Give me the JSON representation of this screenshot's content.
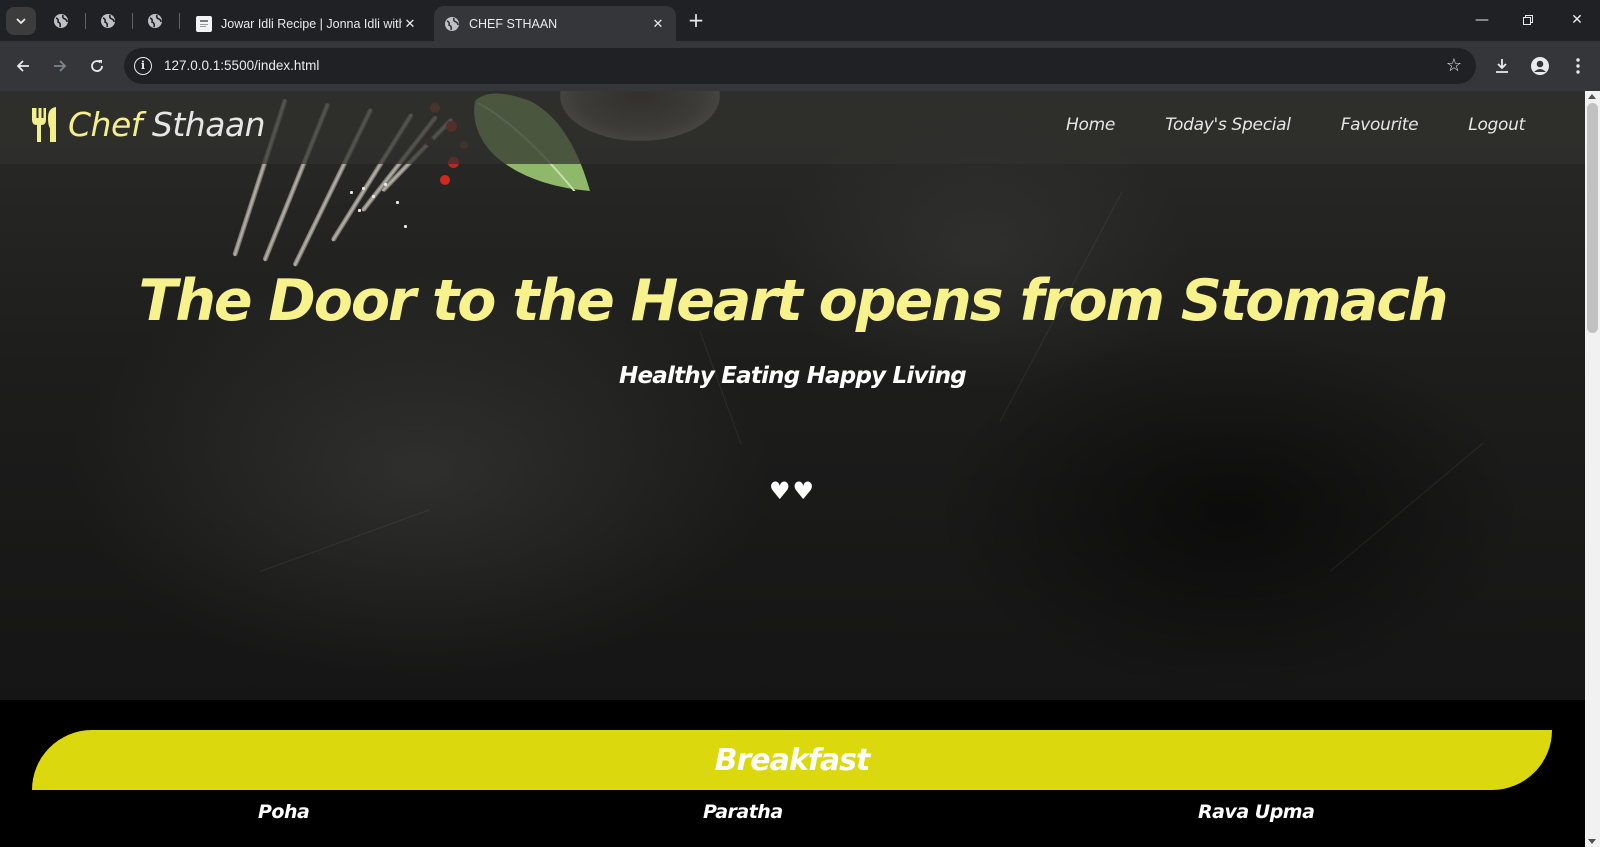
{
  "browser": {
    "tabs": [
      {
        "title": "Jowar Idli Recipe | Jonna Idli with",
        "active": false
      },
      {
        "title": "CHEF STHAAN",
        "active": true
      }
    ],
    "url": "127.0.0.1:5500/index.html"
  },
  "site": {
    "brand": {
      "first": "Chef",
      "second": "Sthaan"
    },
    "nav": [
      "Home",
      "Today's Special",
      "Favourite",
      "Logout"
    ],
    "hero": {
      "headline": "The Door to the Heart opens from Stomach",
      "tagline": "Healthy Eating Happy Living",
      "hearts": "♥♥"
    },
    "section": {
      "title": "Breakfast",
      "dishes": [
        "Poha",
        "Paratha",
        "Rava Upma"
      ]
    }
  },
  "colors": {
    "accent_yellow": "#f7f28b",
    "banner_yellow": "#dcd80e",
    "chrome_dark": "#202124",
    "chrome_toolbar": "#35363a"
  }
}
